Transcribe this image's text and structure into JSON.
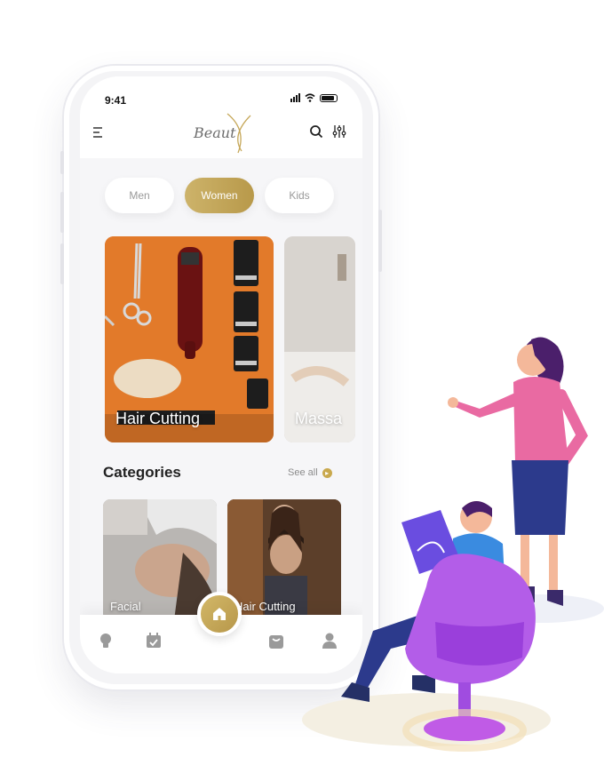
{
  "status": {
    "time": "9:41"
  },
  "header": {
    "logo_text": "Beaut",
    "menu_icon": "menu-icon",
    "search_icon": "search-icon",
    "filter_icon": "filter-icon"
  },
  "segments": [
    {
      "label": "Men",
      "active": false
    },
    {
      "label": "Women",
      "active": true
    },
    {
      "label": "Kids",
      "active": false
    }
  ],
  "featured": [
    {
      "label": "Hair Cutting"
    },
    {
      "label": "Massa"
    }
  ],
  "categories": {
    "title": "Categories",
    "see_all": "See all",
    "items": [
      {
        "label": "Facial"
      },
      {
        "label": "Hair Cutting"
      }
    ]
  },
  "tabbar": {
    "items": [
      "bulb-icon",
      "calendar-icon",
      "home-icon",
      "bag-icon",
      "user-icon"
    ]
  },
  "colors": {
    "accent": "#c6a85a",
    "text": "#222222",
    "muted": "#9a9a9a"
  }
}
